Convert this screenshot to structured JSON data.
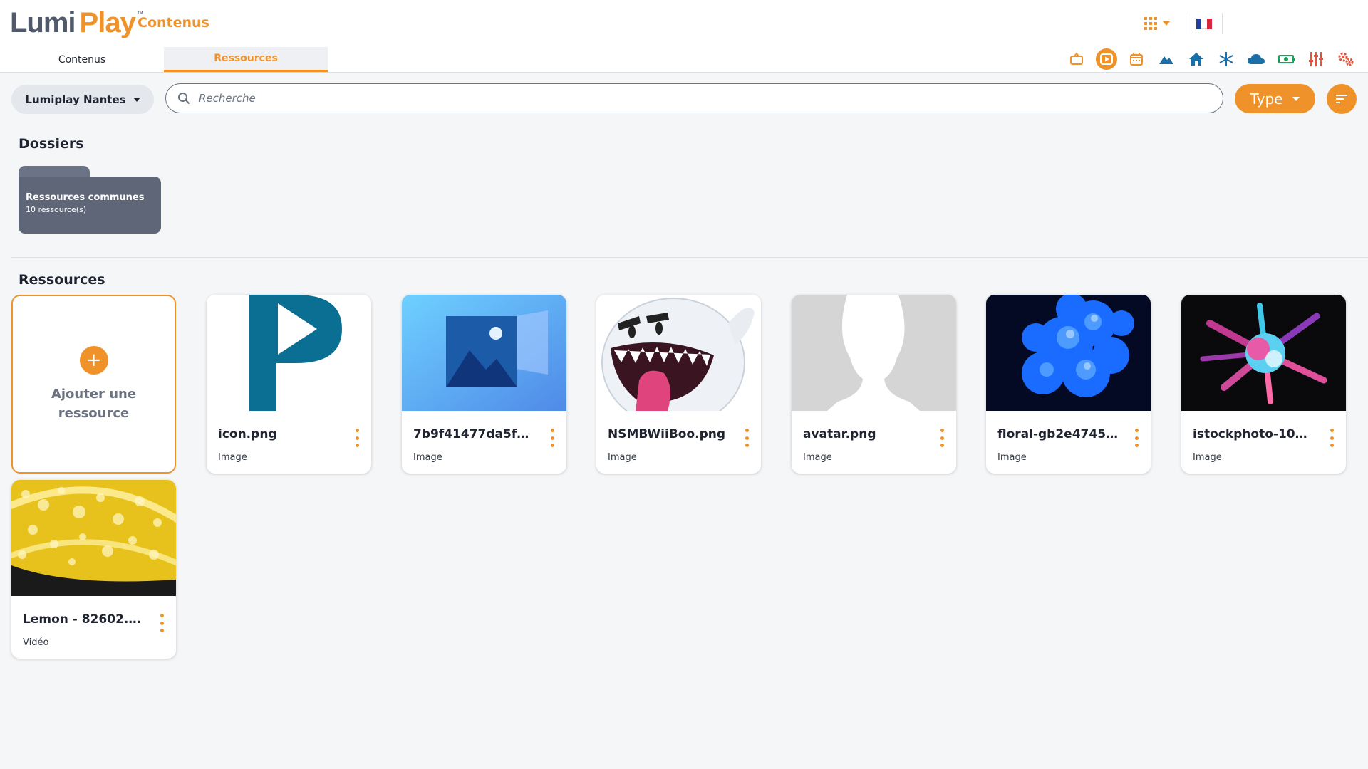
{
  "app": {
    "logo_left": "Lumi",
    "logo_right": "Play",
    "logo_tm": "™",
    "title": "Contenus"
  },
  "colors": {
    "accent": "#f0922a",
    "folder": "#5e6678",
    "text": "#1f2430",
    "muted": "#6b7280"
  },
  "header": {
    "apps_icon": "apps-grid-icon",
    "language_flag": "french-flag-icon",
    "tabs": [
      {
        "label": "Contenus",
        "active": false
      },
      {
        "label": "Ressources",
        "active": true
      }
    ],
    "modules": [
      {
        "icon": "broadcast-icon",
        "color": "#f0922a",
        "active": false
      },
      {
        "icon": "media-play-icon",
        "color": "#ffffff",
        "active": true
      },
      {
        "icon": "calendar-icon",
        "color": "#f0922a",
        "active": false
      },
      {
        "icon": "mountain-icon",
        "color": "#1a6fa8",
        "active": false
      },
      {
        "icon": "home-icon",
        "color": "#1a6fa8",
        "active": false
      },
      {
        "icon": "snowflake-icon",
        "color": "#1a6fa8",
        "active": false
      },
      {
        "icon": "cloud-icon",
        "color": "#1a6fa8",
        "active": false
      },
      {
        "icon": "money-icon",
        "color": "#1e9e5a",
        "active": false
      },
      {
        "icon": "sliders-icon",
        "color": "#e8523a",
        "active": false
      },
      {
        "icon": "settings-icon",
        "color": "#e8523a",
        "active": false
      }
    ]
  },
  "toolbar": {
    "site_label": "Lumiplay Nantes",
    "search_placeholder": "Recherche",
    "type_label": "Type",
    "sort_icon": "sort-icon"
  },
  "folders_section": {
    "title": "Dossiers",
    "folders": [
      {
        "name": "Ressources communes",
        "count": "10 ressource(s)"
      }
    ]
  },
  "resources_section": {
    "title": "Ressources",
    "add_label": "Ajouter une ressource",
    "items": [
      {
        "name": "icon.png",
        "type": "Image",
        "thumb": "p-logo"
      },
      {
        "name": "7b9f41477da5f24...",
        "type": "Image",
        "thumb": "picture-placeholder"
      },
      {
        "name": "NSMBWiiBoo.png",
        "type": "Image",
        "thumb": "ghost"
      },
      {
        "name": "avatar.png",
        "type": "Image",
        "thumb": "avatar-silhouette"
      },
      {
        "name": "floral-gb2e4745f...",
        "type": "Image",
        "thumb": "blue-flowers"
      },
      {
        "name": "istockphoto-1072...",
        "type": "Image",
        "thumb": "color-burst"
      },
      {
        "name": "Lemon - 82602.m...",
        "type": "Vidéo",
        "thumb": "lemon"
      }
    ]
  }
}
